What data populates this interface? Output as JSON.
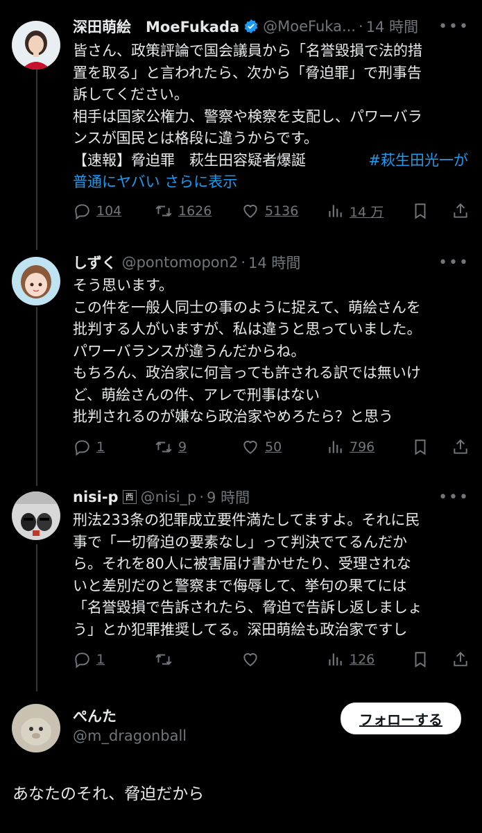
{
  "tweets": [
    {
      "name": "深田萌絵　MoeFukada",
      "handle": "@MoeFuka...",
      "dot": "·",
      "time": "14 時間",
      "lines": [
        "皆さん、政策評論で国会議員から「名誉毀損で法的措",
        "置を取る」と言われたら、次から「脅迫罪」で刑事告",
        "訴してください。",
        "相手は国家公権力、警察や検察を支配し、パワーバラ",
        "ンスが国民とは格段に違うからです。"
      ],
      "line6_text": "【速報】脅迫罪　萩生田容疑者爆誕　",
      "line6_link": "#萩生田光一が",
      "line7_link": "普通にヤバい さらに表示",
      "reply_count": "104",
      "retweet_count": "1626",
      "like_count": "5136",
      "view_count": "14 万"
    },
    {
      "name": "しずく",
      "handle": "@pontomopon2",
      "dot": "·",
      "time": "14 時間",
      "lines": [
        "そう思います。",
        "この件を一般人同士の事のように捉えて、萌絵さんを",
        "批判する人がいますが、私は違うと思っていました。",
        "パワーバランスが違うんだからね。",
        "もちろん、政治家に何言っても許される訳では無いけ",
        "ど、萌絵さんの件、アレで刑事はない",
        "批判されるのが嫌なら政治家やめろたら？と思う"
      ],
      "reply_count": "1",
      "retweet_count": "9",
      "like_count": "50",
      "view_count": "796"
    },
    {
      "name": "nisi-p",
      "badge": "西",
      "handle": "@nisi_p",
      "dot": "·",
      "time": "9 時間",
      "lines": [
        "刑法233条の犯罪成立要件満たしてますよ。それに民",
        "事で「一切脅迫の要素なし」って判決でてるんだか",
        "ら。それを80人に被害届け書かせたり、受理されな",
        "いと差別だのと警察まで侮辱して、挙句の果てには",
        "「名誉毀損で告訴されたら、脅迫で告訴し返しましょ",
        "う」とか犯罪推奨してる。深田萌絵も政治家ですし"
      ],
      "reply_count": "1",
      "retweet_count": "",
      "like_count": "",
      "view_count": "126"
    }
  ],
  "main": {
    "name": "ぺんた",
    "handle": "@m_dragonball",
    "follow_label": "フォローする",
    "text": "あなたのそれ、脅迫だから"
  }
}
